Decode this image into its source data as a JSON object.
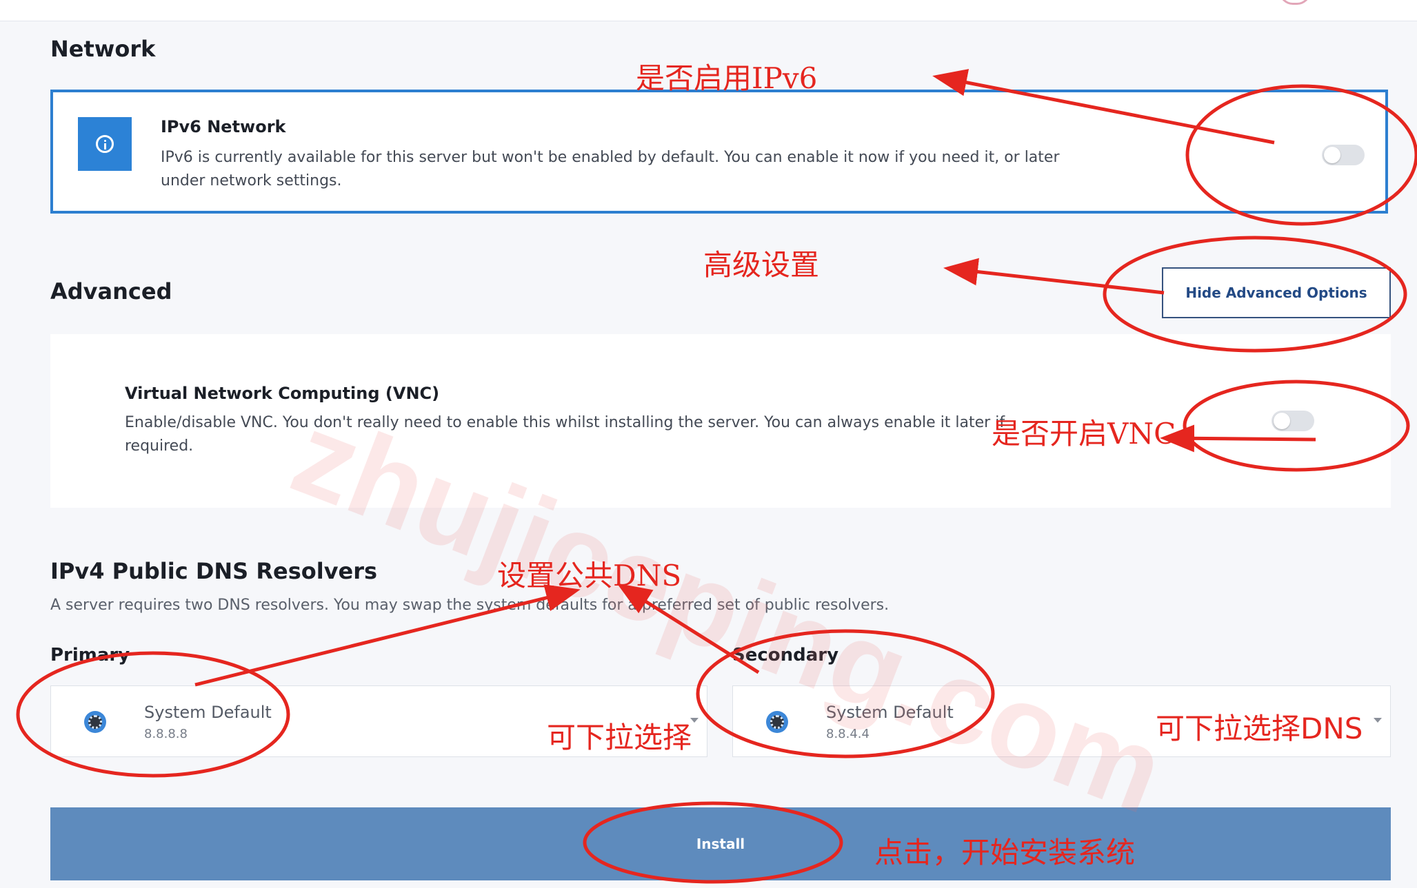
{
  "network": {
    "title": "Network",
    "ipv6": {
      "title": "IPv6 Network",
      "description_line1": "IPv6 is currently available for this server but won't be enabled by default. You can enable it now if you need it, or later",
      "description_line2": "under network settings.",
      "enabled": false
    }
  },
  "advanced": {
    "title": "Advanced",
    "toggle_button_label": "Hide Advanced Options",
    "vnc": {
      "title": "Virtual Network Computing (VNC)",
      "description_line1": "Enable/disable VNC. You don't really need to enable this whilst installing the server. You can always enable it later if",
      "description_line2": "required.",
      "enabled": false
    }
  },
  "dns": {
    "title": "IPv4 Public DNS Resolvers",
    "description": "A server requires two DNS resolvers. You may swap the system defaults for a preferred set of public resolvers.",
    "primary": {
      "label": "Primary",
      "name": "System Default",
      "ip": "8.8.8.8"
    },
    "secondary": {
      "label": "Secondary",
      "name": "System Default",
      "ip": "8.8.4.4"
    }
  },
  "install_button": {
    "label": "Install"
  },
  "watermark": "zhujiceping.com",
  "annotations": {
    "ipv6": "是否启用IPv6",
    "advanced": "高级设置",
    "vnc": "是否开启VNC",
    "dns": "设置公共DNS",
    "primary_dropdown": "可下拉选择",
    "secondary_dropdown": "可下拉选择DNS",
    "install": "点击，开始安装系统"
  },
  "colors": {
    "accent_blue": "#2d7fd0",
    "install_button": "#5e8bbd",
    "annotation_red": "#e5261f"
  }
}
